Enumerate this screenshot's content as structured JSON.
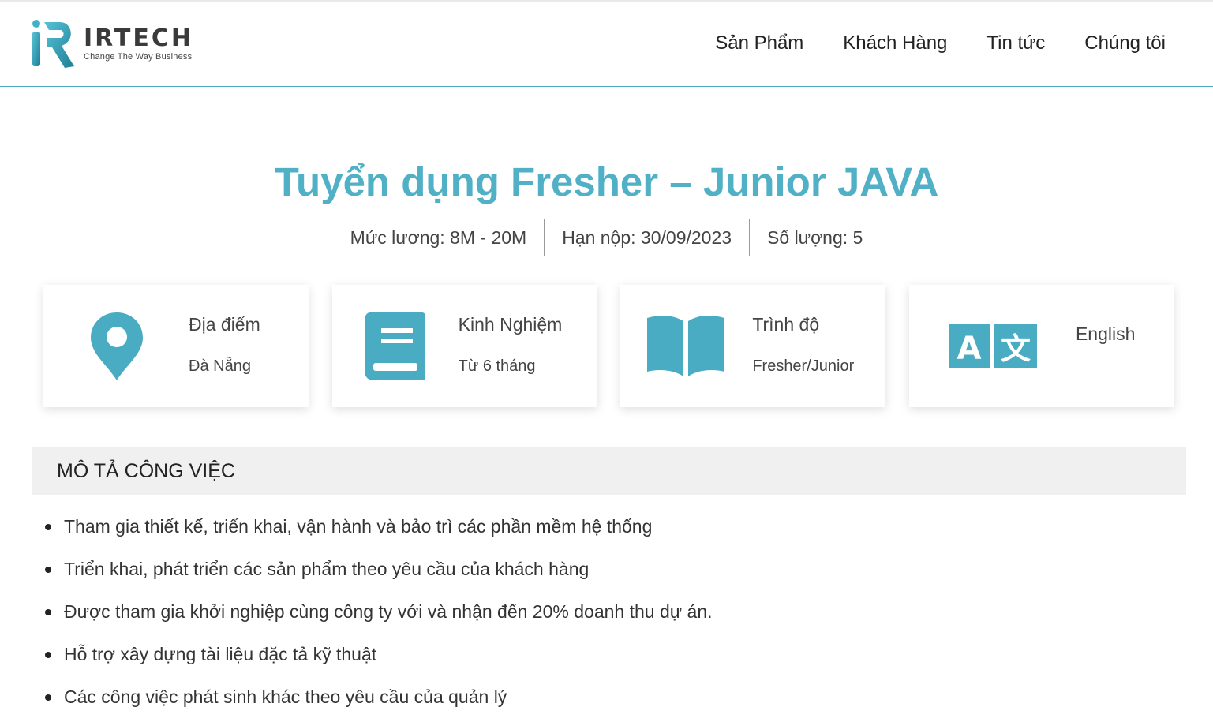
{
  "header": {
    "logo_name": "IRTECH",
    "logo_tagline": "Change The Way Business",
    "nav": [
      "Sản Phẩm",
      "Khách Hàng",
      "Tin tức",
      "Chúng tôi"
    ]
  },
  "job": {
    "title": "Tuyển dụng Fresher – Junior JAVA",
    "salary": "Mức lương: 8M - 20M",
    "deadline": "Hạn nộp: 30/09/2023",
    "quantity": "Số lượng: 5"
  },
  "cards": [
    {
      "icon": "location-pin-icon",
      "label": "Địa điểm",
      "value": "Đà Nẵng"
    },
    {
      "icon": "book-icon",
      "label": "Kinh Nghiệm",
      "value": "Từ 6 tháng"
    },
    {
      "icon": "open-book-icon",
      "label": "Trình độ",
      "value": "Fresher/Junior"
    },
    {
      "icon": "translate-icon",
      "label": "English",
      "value": ""
    }
  ],
  "description": {
    "heading": "MÔ TẢ CÔNG VIỆC",
    "items": [
      "Tham gia thiết kế, triển khai, vận hành và bảo trì các phần mềm hệ thống",
      "Triển khai, phát triển các sản phẩm theo yêu cầu của khách hàng",
      "Được tham gia khởi nghiệp cùng công ty với và nhận đến 20% doanh thu dự án.",
      "Hỗ trợ xây dựng tài liệu đặc tả kỹ thuật",
      "Các công việc phát sinh khác theo yêu cầu của quản lý"
    ]
  },
  "colors": {
    "accent": "#4fb0c6",
    "icon": "#4aacc3",
    "section_bg": "#f0f0f0"
  }
}
